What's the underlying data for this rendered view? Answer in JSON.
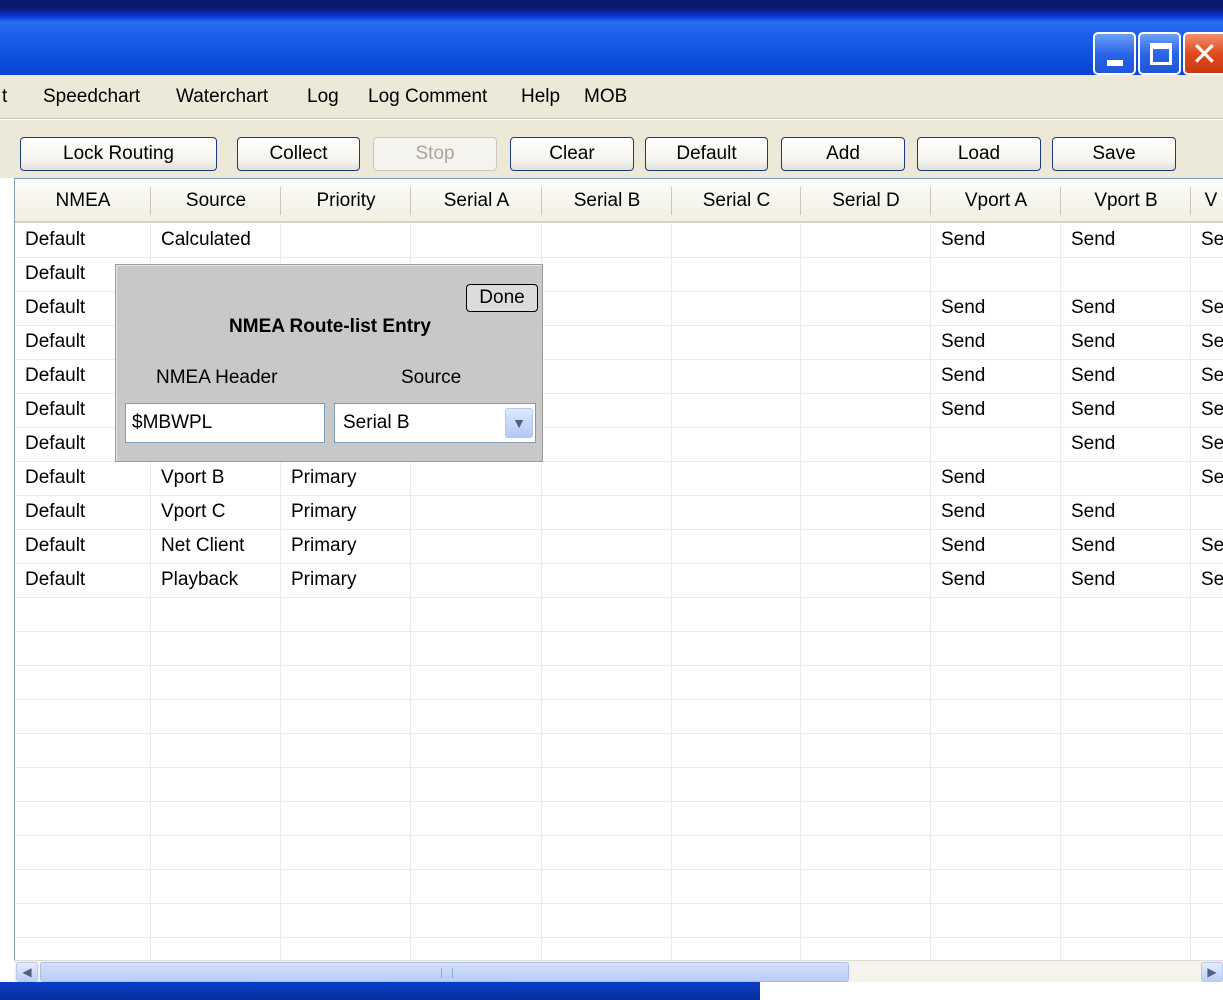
{
  "menu": {
    "items": [
      "t",
      "Speedchart",
      "Waterchart",
      "Log",
      "Log Comment",
      "Help",
      "MOB"
    ]
  },
  "toolbar": {
    "buttons": [
      "Lock Routing",
      "Collect",
      "Stop",
      "Clear",
      "Default",
      "Add",
      "Load",
      "Save"
    ],
    "disabled": [
      "Stop"
    ]
  },
  "table": {
    "columns": [
      "NMEA",
      "Source",
      "Priority",
      "Serial A",
      "Serial B",
      "Serial C",
      "Serial D",
      "Vport A",
      "Vport B",
      "V"
    ],
    "rows": [
      [
        "Default",
        "Calculated",
        "",
        "",
        "",
        "",
        "",
        "Send",
        "Send",
        "Se"
      ],
      [
        "Default",
        "",
        "",
        "",
        "",
        "",
        "",
        "",
        "",
        ""
      ],
      [
        "Default",
        "",
        "",
        "",
        "",
        "",
        "",
        "Send",
        "Send",
        "Se"
      ],
      [
        "Default",
        "",
        "",
        "",
        "",
        "",
        "",
        "Send",
        "Send",
        "Se"
      ],
      [
        "Default",
        "",
        "",
        "",
        "",
        "",
        "",
        "Send",
        "Send",
        "Se"
      ],
      [
        "Default",
        "",
        "",
        "",
        "",
        "",
        "",
        "Send",
        "Send",
        "Se"
      ],
      [
        "Default",
        "",
        "",
        "",
        "",
        "",
        "",
        "",
        "Send",
        "Se"
      ],
      [
        "Default",
        "Vport B",
        "Primary",
        "",
        "",
        "",
        "",
        "Send",
        "",
        "Se"
      ],
      [
        "Default",
        "Vport C",
        "Primary",
        "",
        "",
        "",
        "",
        "Send",
        "Send",
        ""
      ],
      [
        "Default",
        "Net Client",
        "Primary",
        "",
        "",
        "",
        "",
        "Send",
        "Send",
        "Se"
      ],
      [
        "Default",
        "Playback",
        "Primary",
        "",
        "",
        "",
        "",
        "Send",
        "Send",
        "Se"
      ]
    ]
  },
  "popup": {
    "done_label": "Done",
    "title": "NMEA Route-list Entry",
    "header_label": "NMEA Header",
    "source_label": "Source",
    "header_value": "$MBWPL",
    "source_value": "Serial B"
  },
  "icons": {
    "minimize": "minimize-icon",
    "maximize": "maximize-icon",
    "close": "close-icon",
    "dropdown": "chevron-down-icon",
    "scroll_left": "arrow-left-icon",
    "scroll_right": "arrow-right-icon"
  },
  "colors": {
    "titlebar": "#0a48d8",
    "close_button": "#e04a20",
    "popup_background": "#c8c8c8",
    "window_background": "#ece9d8"
  }
}
